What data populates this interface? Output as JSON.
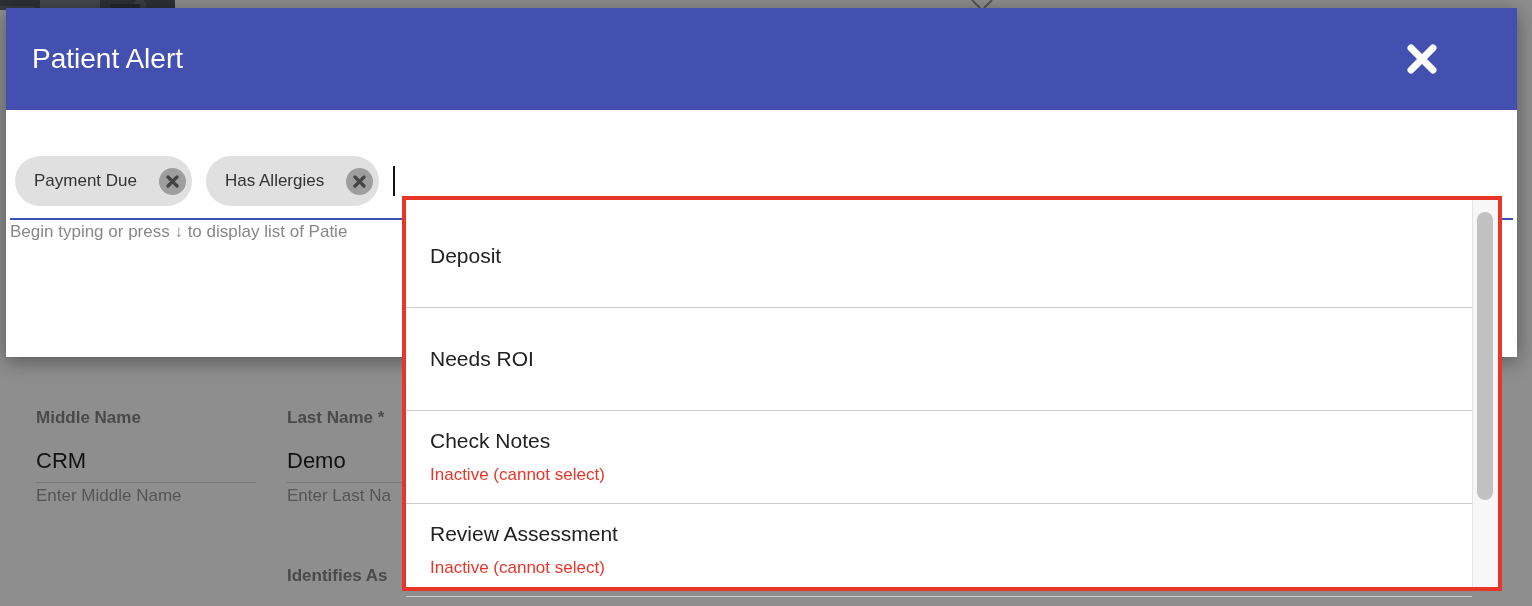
{
  "background_page": {
    "fields": [
      {
        "label": "Middle Name",
        "value": "CRM",
        "hint": "Enter Middle Name"
      },
      {
        "label": "Last Name *",
        "value": "Demo",
        "hint": "Enter Last Na"
      }
    ],
    "extra_label": "Identifies As"
  },
  "dialog": {
    "title": "Patient Alert",
    "chips": [
      {
        "label": "Payment Due"
      },
      {
        "label": "Has Allergies"
      }
    ],
    "helper_text": "Begin typing or press ↓ to display list of Patie",
    "options": [
      {
        "label": "Deposit",
        "inactive": false
      },
      {
        "label": "Needs ROI",
        "inactive": false
      },
      {
        "label": "Check Notes",
        "inactive": true,
        "note": "Inactive (cannot select)"
      },
      {
        "label": "Review Assessment",
        "inactive": true,
        "note": "Inactive (cannot select)"
      }
    ]
  }
}
